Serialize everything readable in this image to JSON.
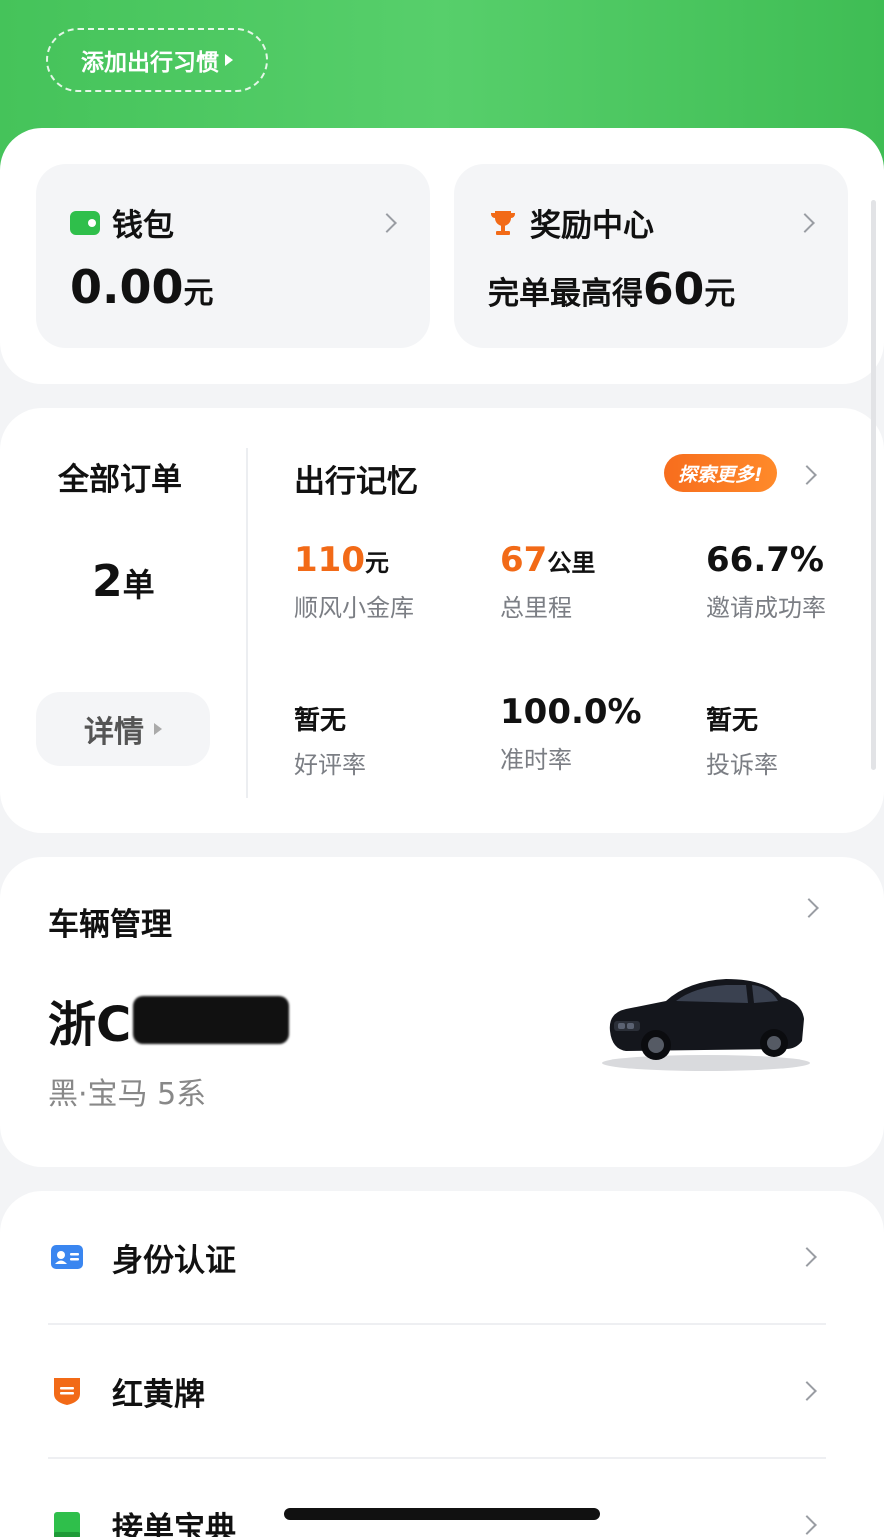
{
  "header": {
    "habit_button": "添加出行习惯"
  },
  "wallet": {
    "title": "钱包",
    "amount": "0.00",
    "unit": "元"
  },
  "reward": {
    "title": "奖励中心",
    "text_prefix": "完单最高得",
    "highlight": "60",
    "unit": "元"
  },
  "orders": {
    "title": "全部订单",
    "count": "2",
    "unit": "单",
    "detail_label": "详情"
  },
  "memory": {
    "title": "出行记忆",
    "badge": "探索更多!",
    "stats": [
      {
        "value": "110",
        "unit": "元",
        "label": "顺风小金库"
      },
      {
        "value": "67",
        "unit": "公里",
        "label": "总里程"
      },
      {
        "value": "66.7%",
        "unit": "",
        "label": "邀请成功率"
      },
      {
        "value": "暂无",
        "unit": "",
        "label": "好评率"
      },
      {
        "value": "100.0%",
        "unit": "",
        "label": "准时率"
      },
      {
        "value": "暂无",
        "unit": "",
        "label": "投诉率"
      }
    ]
  },
  "vehicle": {
    "title": "车辆管理",
    "plate_prefix": "浙C",
    "description": "黑·宝马 5系"
  },
  "menu": {
    "items": [
      {
        "label": "身份认证",
        "icon": "id-card-icon",
        "color": "#3a86f0"
      },
      {
        "label": "红黄牌",
        "icon": "shield-badge-icon",
        "color": "#f26a17"
      },
      {
        "label": "接单宝典",
        "icon": "book-icon",
        "color": "#2fbf4b"
      }
    ]
  },
  "colors": {
    "brand_green": "#45c35a",
    "accent_orange": "#f26a17"
  }
}
